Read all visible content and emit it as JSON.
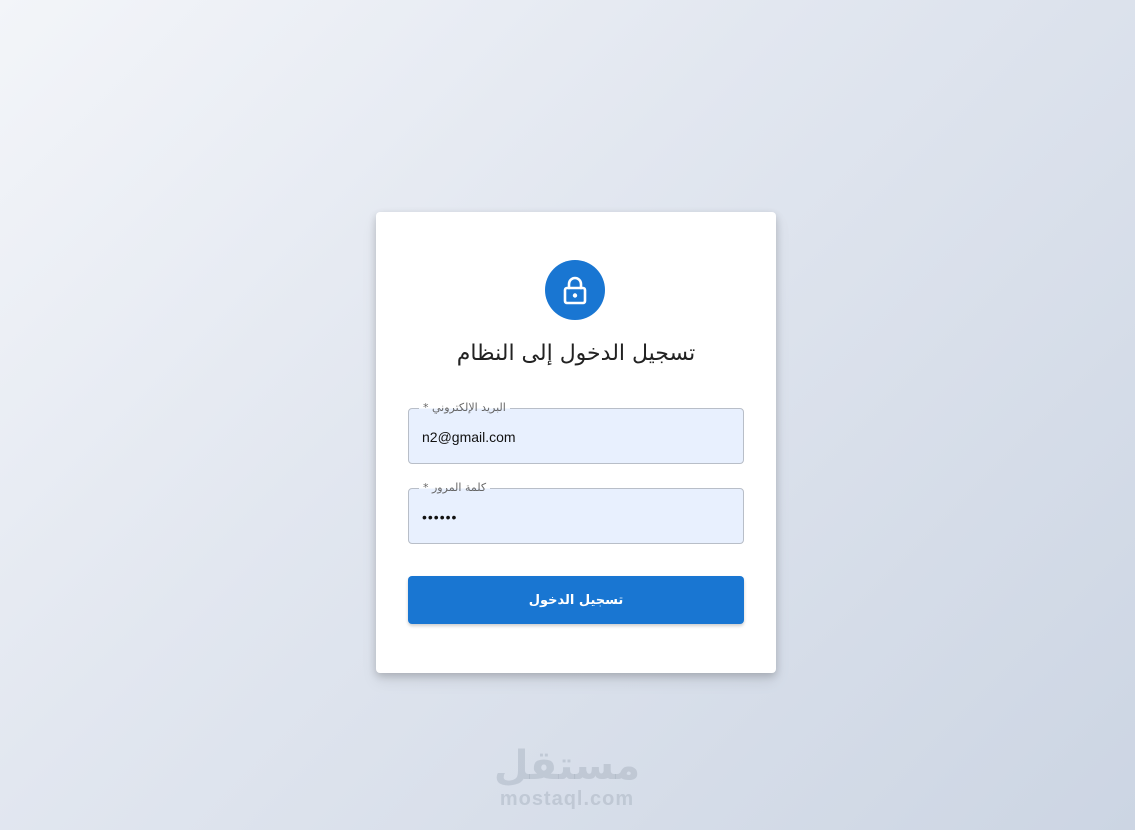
{
  "login": {
    "title": "تسجيل الدخول إلى النظام",
    "icon": "lock-icon",
    "email": {
      "label": "البريد الإلكتروني *",
      "value": "n2@gmail.com"
    },
    "password": {
      "label": "كلمة المرور *",
      "value": "••••••"
    },
    "submit_label": "تسجيل الدخول"
  },
  "watermark": {
    "arabic": "مستقل",
    "latin": "mostaql.com"
  },
  "colors": {
    "primary": "#1976d2",
    "field_bg": "#e8f0fe"
  }
}
